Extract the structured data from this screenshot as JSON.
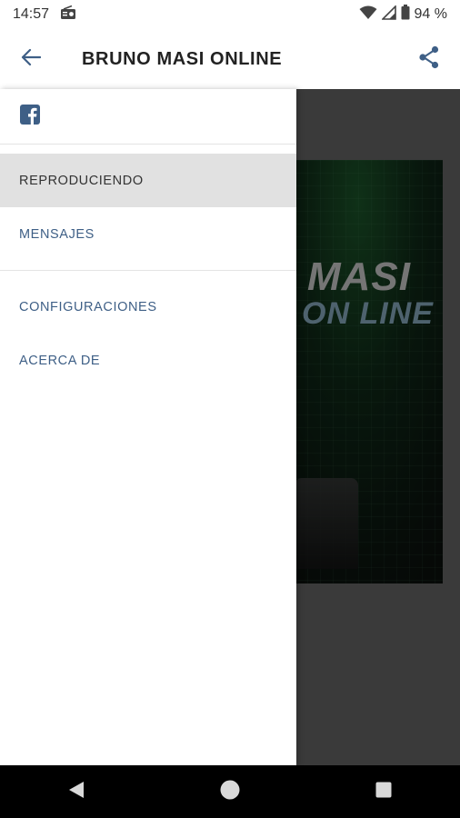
{
  "status_bar": {
    "time": "14:57",
    "battery": "94 %"
  },
  "app_bar": {
    "title": "BRUNO MASI ONLINE"
  },
  "artwork": {
    "line1": "MASI",
    "line2": "ON LINE"
  },
  "drawer": {
    "social_icon": "facebook-icon",
    "group1": [
      {
        "label": "REPRODUCIENDO",
        "active": true
      },
      {
        "label": "MENSAJES",
        "active": false
      }
    ],
    "group2": [
      {
        "label": "CONFIGURACIONES",
        "active": false
      },
      {
        "label": "ACERCA DE",
        "active": false
      }
    ]
  },
  "colors": {
    "accent": "#3e5f86",
    "active_bg": "#e1e1e1",
    "scrim": "#6b6b6b"
  },
  "icons": [
    "back-arrow-icon",
    "share-icon",
    "facebook-icon",
    "radio-icon",
    "wifi-icon",
    "signal-icon",
    "battery-icon",
    "nav-back-icon",
    "nav-home-icon",
    "nav-recents-icon"
  ]
}
